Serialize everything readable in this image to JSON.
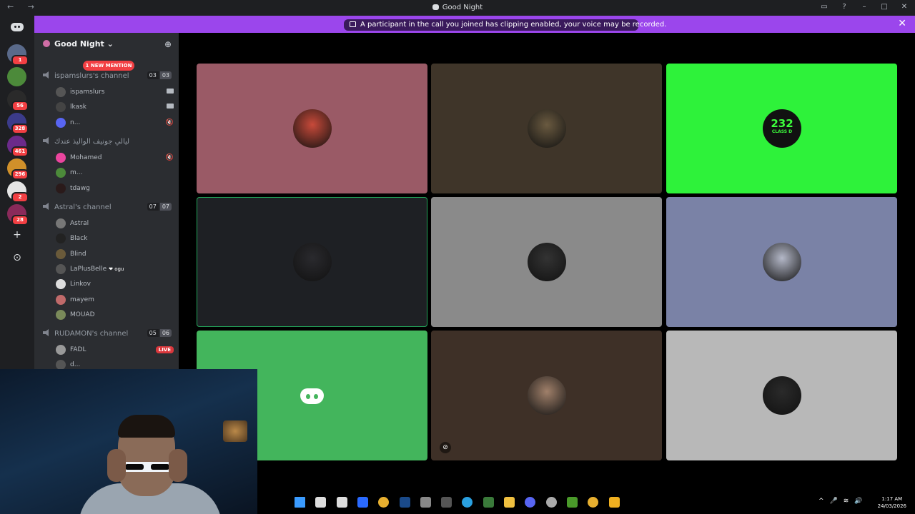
{
  "window": {
    "nav_label": "← →",
    "title": "Good Night",
    "controls": [
      "▭",
      "?",
      "–",
      "□",
      "✕"
    ]
  },
  "notice": {
    "message": "A participant in the call you joined has clipping enabled, your voice may be recorded.",
    "close": "✕"
  },
  "guild_rail": {
    "items": [
      {
        "name": "server-1",
        "badge": "1",
        "color": "#5a6a8a"
      },
      {
        "name": "server-2",
        "badge": "",
        "color": "#4c8a3a"
      },
      {
        "name": "server-3",
        "badge": "56",
        "color": "#2a2a2a"
      },
      {
        "name": "server-4",
        "badge": "328",
        "color": "#3b3b8a"
      },
      {
        "name": "server-5",
        "badge": "461",
        "color": "#6b2a8a"
      },
      {
        "name": "server-6",
        "badge": "296",
        "color": "#d0902a"
      },
      {
        "name": "server-7",
        "badge": "2",
        "color": "#e5e5e5"
      },
      {
        "name": "server-8",
        "badge": "28",
        "color": "#8a2a5a"
      }
    ],
    "add_label": "+",
    "explore_label": "⊙"
  },
  "server": {
    "name": "Good Night ⌄",
    "new_mention": "1 NEW MENTION"
  },
  "channels": [
    {
      "name": "ispamslurs's channel",
      "count_a": "03",
      "count_b": "03",
      "members": [
        {
          "name": "ispamslurs",
          "right": "cam",
          "color": "#555"
        },
        {
          "name": "lkask",
          "right": "cam",
          "color": "#444"
        },
        {
          "name": "n...",
          "right": "🔇",
          "color": "#5865f2"
        }
      ]
    },
    {
      "name": "ليالي جونيف الواليذ عندك",
      "count_a": "",
      "count_b": "",
      "members": [
        {
          "name": "Mohamed",
          "right": "🔇",
          "color": "#eb459e"
        },
        {
          "name": "m...",
          "right": "",
          "color": "#4c8a3a"
        },
        {
          "name": "tdawg",
          "right": "",
          "color": "#2a1a1a"
        }
      ]
    },
    {
      "name": "Astral's channel",
      "count_a": "07",
      "count_b": "07",
      "members": [
        {
          "name": "Astral",
          "right": "",
          "color": "#777"
        },
        {
          "name": "Black",
          "right": "",
          "color": "#222"
        },
        {
          "name": "Blind",
          "right": "",
          "color": "#6a5a3a"
        },
        {
          "name": "LaPlusBelle",
          "right": "",
          "color": "#555",
          "tag": "❤ ogu"
        },
        {
          "name": "Linkov",
          "right": "",
          "color": "#ddd"
        },
        {
          "name": "mayem",
          "right": "",
          "color": "#c06a6a"
        },
        {
          "name": "MOUAD",
          "right": "",
          "color": "#7a8a5a"
        }
      ]
    },
    {
      "name": "RUDAMON's channel",
      "count_a": "05",
      "count_b": "06",
      "members": [
        {
          "name": "FADL",
          "right": "LIVE",
          "color": "#999"
        },
        {
          "name": "d...",
          "right": "",
          "color": "#555"
        }
      ]
    }
  ],
  "tiles": [
    {
      "name": "tile-1",
      "bg": "#9a5a66",
      "avatar": "#c84a3a"
    },
    {
      "name": "tile-2",
      "bg": "#3f3529",
      "avatar": "#6a5a40"
    },
    {
      "name": "tile-3",
      "bg": "#2ef23a",
      "badge_top": "232",
      "badge_bottom": "CLASS D"
    },
    {
      "name": "tile-4",
      "bg": "#1e2024",
      "avatar": "#2a2a2e"
    },
    {
      "name": "tile-5",
      "bg": "#8a8a8a",
      "avatar": "#333"
    },
    {
      "name": "tile-6",
      "bg": "#7a82a6",
      "avatar": "#b4b8c8"
    },
    {
      "name": "tile-7",
      "bg": "#43b55c"
    },
    {
      "name": "tile-8",
      "bg": "#3e3027",
      "avatar": "#a0806a",
      "mute": "⊘"
    },
    {
      "name": "tile-9",
      "bg": "#b8b8b8",
      "avatar": "#2a2a2a"
    }
  ],
  "taskbar": {
    "icons": [
      {
        "name": "start",
        "color": "#3a9bff"
      },
      {
        "name": "taskview",
        "color": "#ddd"
      },
      {
        "name": "todo",
        "color": "#ddd"
      },
      {
        "name": "app-blue",
        "color": "#2a6aff"
      },
      {
        "name": "chrome-1",
        "color": "#e8b030"
      },
      {
        "name": "steam",
        "color": "#1a4a8a"
      },
      {
        "name": "store",
        "color": "#888"
      },
      {
        "name": "calculator",
        "color": "#555"
      },
      {
        "name": "telegram",
        "color": "#2aa0e0"
      },
      {
        "name": "app-green",
        "color": "#3a7a3a"
      },
      {
        "name": "explorer",
        "color": "#f0c040"
      },
      {
        "name": "discord",
        "color": "#5865f2"
      },
      {
        "name": "app-circle",
        "color": "#aaa"
      },
      {
        "name": "terminal",
        "color": "#4a9a2a"
      },
      {
        "name": "chrome-2",
        "color": "#e8b030"
      },
      {
        "name": "rockstar",
        "color": "#f0b020"
      }
    ],
    "time": "1:17 AM",
    "date": "24/03/2026",
    "tray": [
      "^",
      "🎤",
      "≋",
      "🔊"
    ]
  }
}
